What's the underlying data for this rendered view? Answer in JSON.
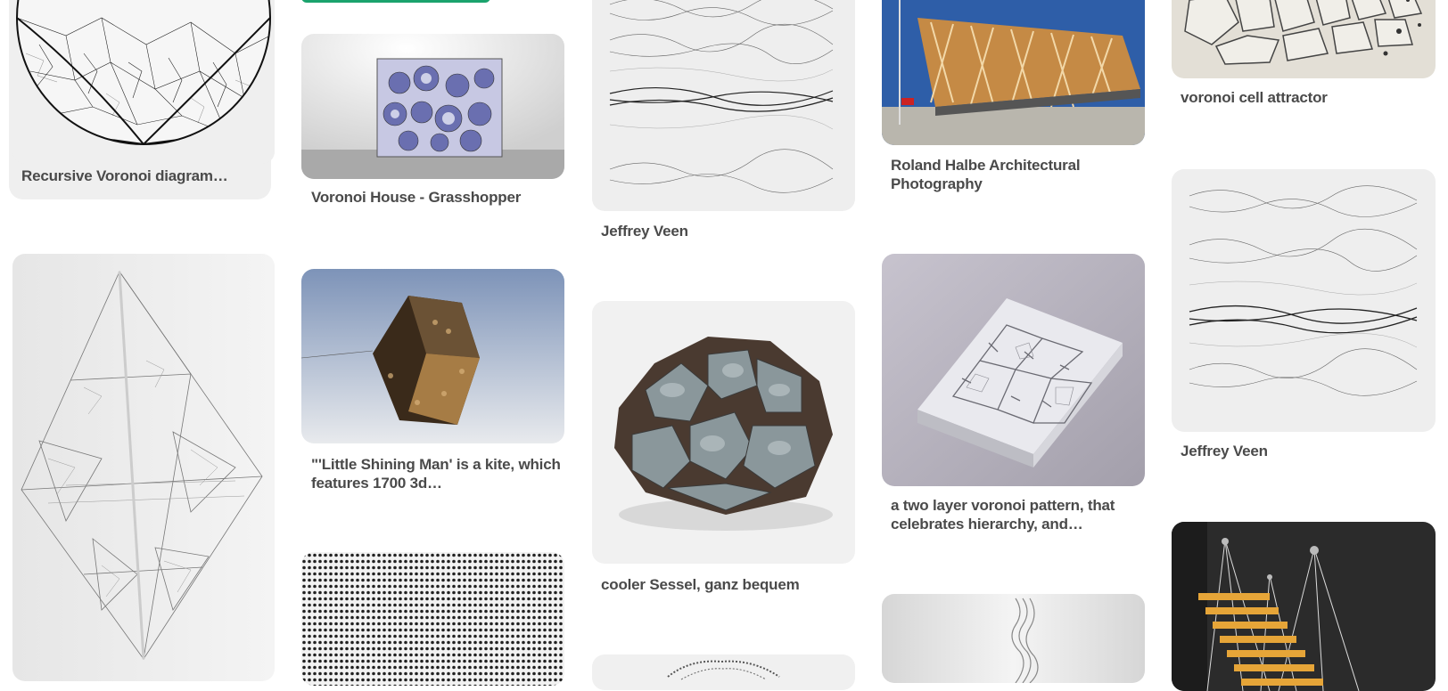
{
  "pins": [
    {
      "id": "recursive-voronoi",
      "title": "Recursive Voronoi diagram…",
      "image": "voronoi-circle-image"
    },
    {
      "id": "voronoi-house",
      "title": "Voronoi House - Grasshopper",
      "image": "voronoi-cube-image"
    },
    {
      "id": "jeffrey-veen-1",
      "title": "Jeffrey Veen",
      "image": "wavy-mesh-image"
    },
    {
      "id": "roland-halbe",
      "title": "Roland Halbe Architectural Photography",
      "image": "timber-building-image"
    },
    {
      "id": "voronoi-cell-attractor",
      "title": "voronoi cell attractor",
      "image": "voronoi-tiles-image"
    },
    {
      "id": "fractal-diamond",
      "title": "",
      "image": "fractal-tetrahedron-image"
    },
    {
      "id": "little-shining-man",
      "title": "\"'Little Shining Man' is a kite, which features 1700 3d…",
      "image": "kite-cube-image"
    },
    {
      "id": "cooler-sessel",
      "title": "cooler Sessel, ganz bequem",
      "image": "pebble-chair-image"
    },
    {
      "id": "two-layer-voronoi",
      "title": "a two layer voronoi pattern, that celebrates hierarchy, and…",
      "image": "voronoi-panel-image"
    },
    {
      "id": "jeffrey-veen-2",
      "title": "Jeffrey Veen",
      "image": "wavy-mesh-image"
    },
    {
      "id": "dot-pattern",
      "title": "",
      "image": "dot-pattern-image"
    },
    {
      "id": "lace-item",
      "title": "",
      "image": "lace-image"
    },
    {
      "id": "white-sculpture",
      "title": "",
      "image": "white-sculpture-image"
    },
    {
      "id": "floating-stairs",
      "title": "",
      "image": "floating-stairs-image"
    }
  ],
  "colors": {
    "title_text": "#4a4a4a",
    "hover_bg": "#efefef",
    "accent_green": "#1aa36d"
  }
}
